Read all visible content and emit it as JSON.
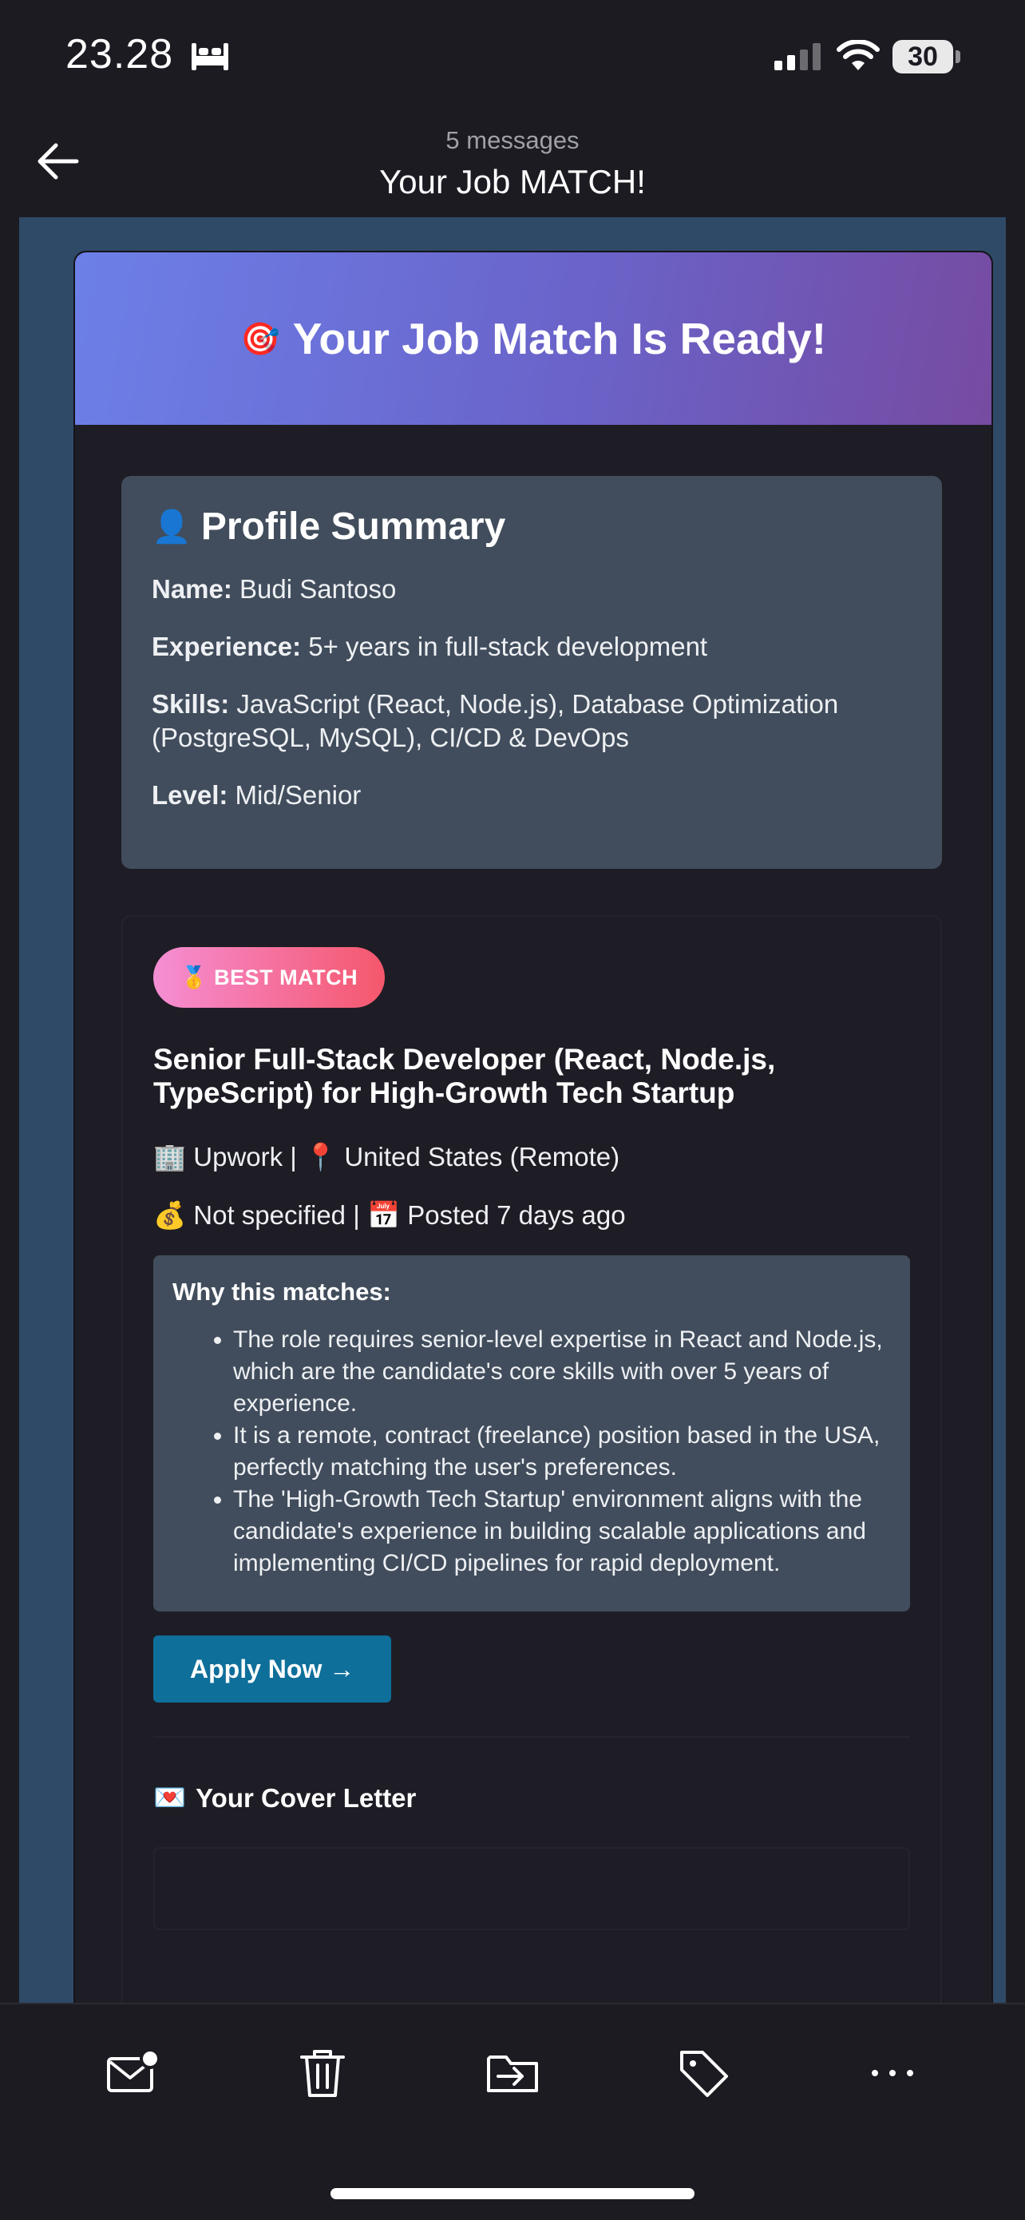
{
  "status_bar": {
    "time": "23.28",
    "battery": "30"
  },
  "nav": {
    "message_count": "5 messages",
    "title": "Your Job MATCH!"
  },
  "email": {
    "banner_emoji": "🎯",
    "banner_title": "Your Job Match Is Ready!",
    "profile": {
      "emoji": "👤",
      "heading": "Profile Summary",
      "name_label": "Name:",
      "name": "Budi Santoso",
      "experience_label": "Experience:",
      "experience": "5+ years in full-stack development",
      "skills_label": "Skills:",
      "skills": "JavaScript (React, Node.js), Database Optimization (PostgreSQL, MySQL), CI/CD & DevOps",
      "level_label": "Level:",
      "level": "Mid/Senior"
    },
    "job": {
      "badge_emoji": "🥇",
      "badge": "BEST MATCH",
      "title": "Senior Full-Stack Developer (React, Node.js, TypeScript) for High-Growth Tech Startup",
      "company_emoji": "🏢",
      "company": "Upwork",
      "location_emoji": "📍",
      "location": "United States (Remote)",
      "salary_emoji": "💰",
      "salary": "Not specified",
      "posted_emoji": "📅",
      "posted": "Posted 7 days ago",
      "separator": "|",
      "why_heading": "Why this matches:",
      "reasons": [
        "The role requires senior-level expertise in React and Node.js, which are the candidate's core skills with over 5 years of experience.",
        "It is a remote, contract (freelance) position based in the USA, perfectly matching the user's preferences.",
        "The 'High-Growth Tech Startup' environment aligns with the candidate's experience in building scalable applications and implementing CI/CD pipelines for rapid deployment."
      ],
      "apply_label": "Apply Now →"
    },
    "cover_letter": {
      "emoji": "💌",
      "heading": "Your Cover Letter"
    }
  },
  "toolbar": {
    "items": [
      "unread-mail",
      "trash",
      "move-to-folder",
      "tag",
      "more"
    ]
  }
}
